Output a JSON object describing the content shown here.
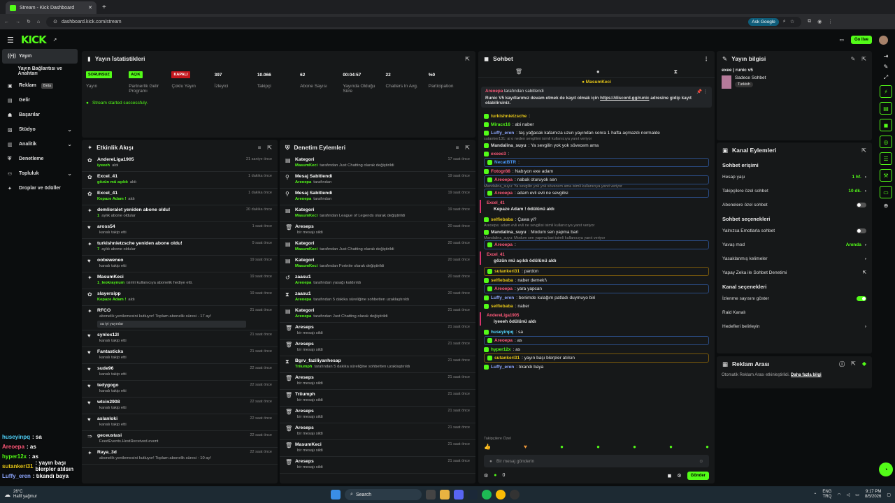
{
  "browser": {
    "tab_title": "Stream - Kick Dashboard",
    "url": "dashboard.kick.com/stream",
    "ask_google": "Ask Google"
  },
  "topnav": {
    "logo": "KICK",
    "golive": "Go live"
  },
  "sidebar": [
    {
      "label": "Yayın",
      "icon": "broadcast-icon",
      "active": true
    },
    {
      "label": "Yayın Bağlantısı ve Anahtarı",
      "icon": "key-icon"
    },
    {
      "label": "Reklam",
      "icon": "ad-icon",
      "badge": "Beta"
    },
    {
      "label": "Gelir",
      "icon": "money-icon"
    },
    {
      "label": "Başarılar",
      "icon": "trophy-icon"
    },
    {
      "label": "Stüdyo",
      "icon": "studio-icon",
      "chevron": true
    },
    {
      "label": "Analitik",
      "icon": "chart-icon",
      "chevron": true
    },
    {
      "label": "Denetleme",
      "icon": "shield-icon"
    },
    {
      "label": "Topluluk",
      "icon": "users-icon",
      "chevron": true
    },
    {
      "label": "Droplar ve ödüller",
      "icon": "gift-icon"
    }
  ],
  "stats": {
    "title": "Yayın İstatistikleri",
    "items": [
      {
        "value": "SORUNSUZ",
        "label": "Yayın",
        "badge": "#53fc18"
      },
      {
        "value": "AÇIK",
        "label": "Partnerlik Gelir Programı",
        "badge": "#53fc18"
      },
      {
        "value": "KAPALI",
        "label": "Çoklu Yayın",
        "badge": "#c4161c"
      },
      {
        "value": "397",
        "label": "İzleyici"
      },
      {
        "value": "10.066",
        "label": "Takipçi"
      },
      {
        "value": "62",
        "label": "Abone Sayısı"
      },
      {
        "value": "00:04:57",
        "label": "Yayında Olduğu Süre"
      },
      {
        "value": "22",
        "label": "Chatters In Avg."
      },
      {
        "value": "%0",
        "label": "Participation"
      }
    ],
    "message": "Stream started successfuly."
  },
  "activity": {
    "title": "Etkinlik Akışı",
    "items": [
      {
        "t": "AndereLiga1905",
        "s": "iyeeeh",
        "s2": "aldı",
        "tm": "21 saniye önce"
      },
      {
        "t": "Excel_41",
        "s": "gözün mü açıldı",
        "s2": "aldı",
        "tm": "1 dakika önce"
      },
      {
        "t": "Excel_41",
        "s": "Kepaze Adam !",
        "s2": "aldı",
        "tm": "1 dakika önce"
      },
      {
        "t": "demlioralet yeniden abone oldu!",
        "s": "1",
        "s2": "aylık abone oldular",
        "tm": "20 dakika önce"
      },
      {
        "t": "aross54",
        "s": "",
        "s2": "kanalı takip etti",
        "tm": "1 saat önce"
      },
      {
        "t": "turkishnietzsche yeniden abone oldu!",
        "s": "7",
        "s2": "aylık abone oldular",
        "tm": "9 saat önce"
      },
      {
        "t": "oobeweneo",
        "s": "",
        "s2": "kanalı takip etti",
        "tm": "19 saat önce"
      },
      {
        "t": "MasumKeci",
        "s": "1_leokraynum",
        "s2": "isimli kullanıcıya abonelik hediye etti.",
        "tm": "19 saat önce"
      },
      {
        "t": "slayersipp",
        "s": "Kepaze Adam !",
        "s2": "aldı",
        "tm": "19 saat önce"
      },
      {
        "t": "RFCO",
        "s": "",
        "s2": "abonelik yenilemesini kutluyor! Toplam abonelik süresi - 17 ay!",
        "tm": "21 saat önce",
        "quote": "sa iyi yayınlar"
      },
      {
        "t": "synlox12l",
        "s": "",
        "s2": "kanalı takip etti",
        "tm": "21 saat önce"
      },
      {
        "t": "Fantasticks",
        "s": "",
        "s2": "kanalı takip etti",
        "tm": "21 saat önce"
      },
      {
        "t": "sude96",
        "s": "",
        "s2": "kanalı takip etti",
        "tm": "22 saat önce"
      },
      {
        "t": "tedygogo",
        "s": "",
        "s2": "kanalı takip etti",
        "tm": "22 saat önce"
      },
      {
        "t": "wtcin2908",
        "s": "",
        "s2": "kanalı takip etti",
        "tm": "22 saat önce"
      },
      {
        "t": "aslanloki",
        "s": "",
        "s2": "kanalı takip etti",
        "tm": "22 saat önce"
      },
      {
        "t": "geceustasi",
        "s": "",
        "s2": "FeedEvents.HostReceived.event",
        "tm": "22 saat önce"
      },
      {
        "t": "Raya_3d",
        "s": "",
        "s2": "abonelik yenilemesini kutluyor! Toplam abonelik süresi - 10 ay!",
        "tm": "22 saat önce"
      }
    ]
  },
  "mod": {
    "title": "Denetim Eylemleri",
    "items": [
      {
        "t": "Kategori",
        "s": "MasumKeci",
        "s2": "tarafından Just Chatting olarak değiştirildi",
        "tm": "17 saat önce"
      },
      {
        "t": "Mesaj Sabitlendi",
        "s": "Areoepa",
        "s2": "tarafından",
        "tm": "19 saat önce"
      },
      {
        "t": "Mesaj Sabitlendi",
        "s": "Areoepa",
        "s2": "tarafından",
        "tm": "19 saat önce"
      },
      {
        "t": "Kategori",
        "s": "MasumKeci",
        "s2": "tarafından League of Legends olarak değiştirildi",
        "tm": "19 saat önce"
      },
      {
        "t": "Areseps",
        "s": "",
        "s2": "bir mesajı sildi",
        "tm": "20 saat önce"
      },
      {
        "t": "Kategori",
        "s": "MasumKeci",
        "s2": "tarafından Just Chatting olarak değiştirildi",
        "tm": "20 saat önce"
      },
      {
        "t": "Kategori",
        "s": "MasumKeci",
        "s2": "tarafından Fortnite olarak değiştirildi",
        "tm": "20 saat önce"
      },
      {
        "t": "zaasu1",
        "s": "Areoepa",
        "s2": "tarafından yasağı kaldırıldı",
        "tm": "20 saat önce"
      },
      {
        "t": "zaasu1",
        "s": "Areoepa",
        "s2": "tarafından 5 dakika süreliğine sohbetten uzaklaştırıldı",
        "tm": "20 saat önce"
      },
      {
        "t": "Kategori",
        "s": "Areoepa",
        "s2": "tarafından Just Chatting olarak değiştirildi",
        "tm": "21 saat önce"
      },
      {
        "t": "Areseps",
        "s": "",
        "s2": "bir mesajı sildi",
        "tm": "21 saat önce"
      },
      {
        "t": "Areseps",
        "s": "",
        "s2": "bir mesajı sildi",
        "tm": "21 saat önce"
      },
      {
        "t": "Bgrv_faziliyanhesap",
        "s": "Triiumph",
        "s2": "tarafından 5 dakika süreliğine sohbetten uzaklaştırıldı",
        "tm": "21 saat önce"
      },
      {
        "t": "Areseps",
        "s": "",
        "s2": "bir mesajı sildi",
        "tm": "21 saat önce"
      },
      {
        "t": "Triiumph",
        "s": "",
        "s2": "bir mesajı sildi",
        "tm": "21 saat önce"
      },
      {
        "t": "Areseps",
        "s": "",
        "s2": "bir mesajı sildi",
        "tm": "21 saat önce"
      },
      {
        "t": "Areseps",
        "s": "",
        "s2": "bir mesajı sildi",
        "tm": "21 saat önce"
      },
      {
        "t": "MasumKeci",
        "s": "",
        "s2": "bir mesajı sildi",
        "tm": "21 saat önce"
      },
      {
        "t": "Areseps",
        "s": "",
        "s2": "bir mesajı sildi",
        "tm": "21 saat önce"
      }
    ]
  },
  "chat": {
    "title": "Sohbet",
    "pinned_by": "MasumKeci",
    "pinned_user": "Areoepa",
    "pinned_suffix": "tarafından sabitlendi",
    "pinned_text": "Runic V5 kayıtlarımız devam etmek de kayıt olmak için",
    "pinned_link": "https://discord.gg/runic",
    "pinned_text2": "adresine gidip kayıt olabilirsiniz.",
    "messages": [
      {
        "u": "turkishnietzsche",
        "c": "#e6c619",
        "m": ":"
      },
      {
        "u": "Miracx16",
        "c": "#53fc18",
        "m": ": abi naber"
      },
      {
        "u": "Luffy_eren",
        "c": "#8fa8ff",
        "m": ": taş yağacak kafamıza uzun yayından sonra 1 hafta açmazdı normalde"
      },
      {
        "reply": "sutanker131: ai o neden sevgilimi isimli kullanıcıya yanıt veriyor"
      },
      {
        "u": "Mandalina_suyu",
        "c": "#dddddd",
        "m": ": Ya sevgilin yok yok sövecem ama"
      },
      {
        "u": "exeee3",
        "c": "#ff5a7a",
        "m": ":"
      },
      {
        "u": "NecatBTR",
        "c": "#4a9bff",
        "m": ":",
        "box": "blue"
      },
      {
        "u": "Fotogr88",
        "c": "#ff5a7a",
        "m": ": Nabıyon exe adam"
      },
      {
        "u": "Areoepa",
        "c": "#ff5a7a",
        "m": ": nabak oturuyok sen",
        "box": "blue"
      },
      {
        "reply": "Mandalina_suyu: Ya sevgilin yok yok sövecem ama isimli kullanıcıya yanıt veriyor"
      },
      {
        "u": "Areoepa",
        "c": "#ff5a7a",
        "m": ": adam evli evli ne sevgilisi",
        "box": "blue"
      },
      {
        "redeem": "Excel_41",
        "r": "Kepaze Adam ! ödülünü aldı"
      },
      {
        "u": "selfiebaba",
        "c": "#e6c619",
        "m": ": Çawa yi?"
      },
      {
        "reply": "Areoepa: adam evli evli ne sevgilisi isimli kullanıcıya yanıt veriyor"
      },
      {
        "u": "Mandalina_suyu",
        "c": "#dddddd",
        "m": ": Modum sen yapma bari"
      },
      {
        "reply": "Mandalina_suyu: Modum sen yapma bari isimli kullanıcıya yanıt veriyor"
      },
      {
        "u": "Areoepa",
        "c": "#ff5a7a",
        "m": ":",
        "box": "blue"
      },
      {
        "redeem": "Excel_41",
        "r": "gözün mü açıldı ödülünü aldı"
      },
      {
        "u": "sutankeri31",
        "c": "#e6c619",
        "m": ": pardon",
        "box": "gold"
      },
      {
        "u": "selfiebaba",
        "c": "#e6c619",
        "m": ": naber demek!\\"
      },
      {
        "u": "Areoepa",
        "c": "#ff5a7a",
        "m": ": yara yapcan",
        "box": "blue"
      },
      {
        "u": "Luffy_eren",
        "c": "#8fa8ff",
        "m": ": benimde kulağım patladı duymuyo biri"
      },
      {
        "u": "selfiebaba",
        "c": "#e6c619",
        "m": ": naber"
      },
      {
        "redeem": "AndereLiga1905",
        "r": "iyeeeh ödülünü aldı"
      },
      {
        "u": "huseyinpq",
        "c": "#53d6ff",
        "m": ": sa"
      },
      {
        "u": "Areoepa",
        "c": "#ff5a7a",
        "m": ": as",
        "box": "blue"
      },
      {
        "u": "hyper12x",
        "c": "#53fc18",
        "m": ": as"
      },
      {
        "u": "sutankeri31",
        "c": "#e6c619",
        "m": ": yayın başı blerpler atılsın",
        "box": "gold"
      },
      {
        "u": "Luffy_eren",
        "c": "#8fa8ff",
        "m": ": tıkandı baya"
      }
    ],
    "followers_only": "Takipçilere Özel",
    "input_placeholder": "Bir mesaj gönderin",
    "send": "Gönder",
    "count": "0"
  },
  "info": {
    "title": "Yayın bilgisi",
    "stream_title": "exee | runic v5",
    "category": "Sadece Sohbet",
    "tag": "Turkish"
  },
  "channel": {
    "title": "Kanal Eylemleri",
    "chat_access": "Sohbet erişimi",
    "access": [
      {
        "l": "Hesap yaşı",
        "v": "1 hf."
      },
      {
        "l": "Takipçilere özel sohbet",
        "v": "10 dk."
      },
      {
        "l": "Abonelere özel sohbet",
        "toggle": false
      }
    ],
    "chat_opts": "Sohbet seçenekleri",
    "opts": [
      {
        "l": "Yalnızca Emotlarla sohbet",
        "toggle": false
      },
      {
        "l": "Yavaş mod",
        "v": "Anında"
      },
      {
        "l": "Yasaklanmış kelimeler",
        "chev": true
      },
      {
        "l": "Yapay Zeka ile Sohbet Denetimi",
        "ext": true
      }
    ],
    "channel_opts": "Kanal seçenekleri",
    "copts": [
      {
        "l": "İzlenme sayısını göster",
        "toggle": true
      },
      {
        "l": "Raid Kanalı"
      },
      {
        "l": "Hedefleri belirleyin",
        "chev": true
      }
    ]
  },
  "ads": {
    "title": "Reklam Arası",
    "text": "Otomatik Reklam Arası etkinleştirildi.",
    "link": "Daha fazla bilgi"
  },
  "overlay": [
    {
      "u": "huseyinpq",
      "c": "#53d6ff",
      "m": ": sa"
    },
    {
      "u": "Areoepa",
      "c": "#ff5a7a",
      "m": ": as"
    },
    {
      "u": "hyper12x",
      "c": "#53fc18",
      "m": ": as"
    },
    {
      "u": "sutankeri31",
      "c": "#e6c619",
      "m": ": yayın başı blerpler atılsın"
    },
    {
      "u": "Luffy_eren",
      "c": "#8fa8ff",
      "m": ": tıkandı baya"
    }
  ],
  "taskbar": {
    "temp": "26°C",
    "weather": "Hafif yağmur",
    "search": "Search",
    "lang": "ENG",
    "lang2": "TRQ",
    "time": "9:17 PM",
    "date": "8/5/2026"
  }
}
